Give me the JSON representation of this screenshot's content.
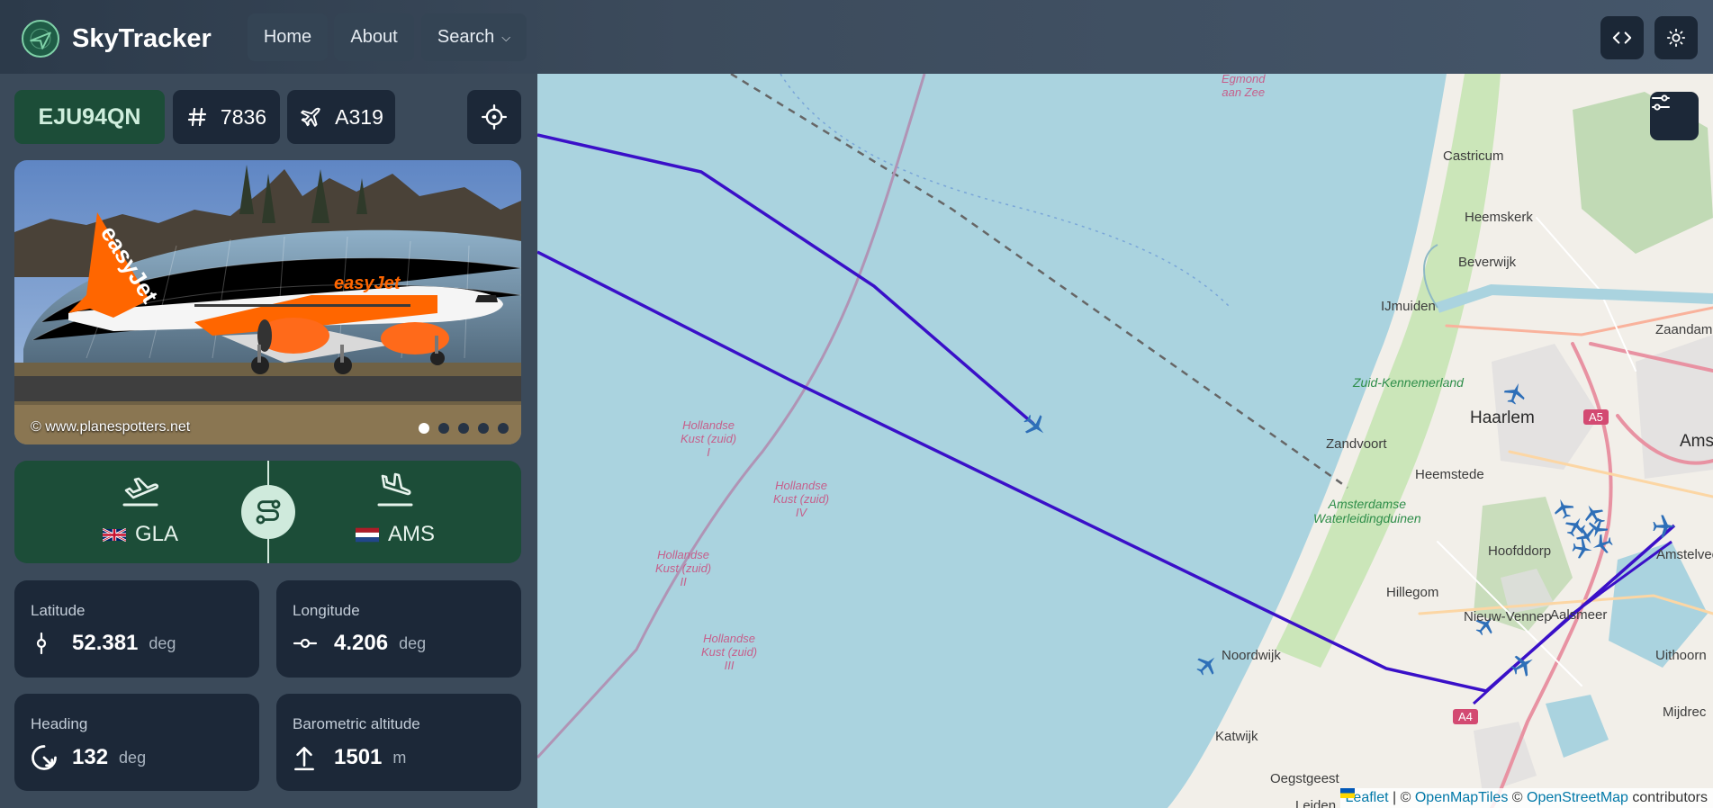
{
  "header": {
    "brand": "SkyTracker",
    "nav": [
      {
        "label": "Home"
      },
      {
        "label": "About"
      },
      {
        "label": "Search"
      }
    ]
  },
  "flight": {
    "callsign": "EJU94QN",
    "flight_number": "7836",
    "aircraft_type": "A319",
    "photo_credit": "© www.planespotters.net",
    "photo_count": 5,
    "photo_active_index": 0,
    "origin": {
      "code": "GLA"
    },
    "destination": {
      "code": "AMS"
    }
  },
  "stats": [
    {
      "label": "Latitude",
      "value": "52.381",
      "unit": "deg"
    },
    {
      "label": "Longitude",
      "value": "4.206",
      "unit": "deg"
    },
    {
      "label": "Heading",
      "value": "132",
      "unit": "deg"
    },
    {
      "label": "Barometric altitude",
      "value": "1501",
      "unit": "m"
    }
  ],
  "map": {
    "labels": {
      "egmond": "Egmond\naan Zee",
      "castricum": "Castricum",
      "heemskerk": "Heemskerk",
      "beverwijk": "Beverwijk",
      "ijmuiden": "IJmuiden",
      "zaandam": "Zaandam",
      "zuid_kennemerland": "Zuid-Kennemerland",
      "haarlem": "Haarlem",
      "amst": "Amst",
      "zandvoort": "Zandvoort",
      "heemstede": "Heemstede",
      "awd": "Amsterdamse\nWaterleidingduinen",
      "hoofddorp": "Hoofddorp",
      "amstelvee": "Amstelvee",
      "hillegom": "Hillegom",
      "nieuw_vennep": "Nieuw-Vennep",
      "aalsmeer": "Aalsmeer",
      "uithoorn": "Uithoorn",
      "noordwijk": "Noordwijk",
      "katwijk": "Katwijk",
      "oegstgeest": "Oegstgeest",
      "leiden": "Leiden",
      "mijdrecht": "Mijdrec",
      "hk_zuid_i": "Hollandse\nKust (zuid)\nI",
      "hk_zuid_iv": "Hollandse\nKust (zuid)\nIV",
      "hk_zuid_ii": "Hollandse\nKust (zuid)\nII",
      "hk_zuid_iii": "Hollandse\nKust (zuid)\nIII",
      "a5": "A5",
      "a4": "A4"
    },
    "attribution": {
      "leaflet": "Leaflet",
      "sep1": " | © ",
      "omt": "OpenMapTiles",
      "sep2": " © ",
      "osm": "OpenStreetMap",
      "contrib": " contributors"
    },
    "colors": {
      "sea": "#aad3df",
      "land": "#f2efe9",
      "track": "#3a10c8",
      "plane": "#2e6fb8"
    }
  }
}
